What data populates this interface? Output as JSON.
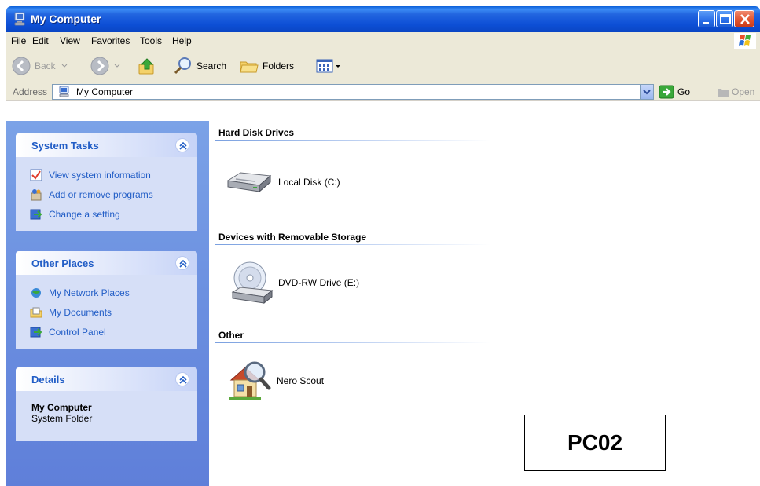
{
  "window": {
    "title": "My Computer"
  },
  "menu": [
    "File",
    "Edit",
    "View",
    "Favorites",
    "Tools",
    "Help"
  ],
  "toolbar": {
    "back_label": "Back",
    "search_label": "Search",
    "folders_label": "Folders"
  },
  "address": {
    "label": "Address",
    "value": "My Computer",
    "go_label": "Go",
    "open_label": "Open"
  },
  "task_pane": {
    "system_tasks": {
      "title": "System Tasks",
      "items": [
        "View system information",
        "Add or remove programs",
        "Change a setting"
      ]
    },
    "other_places": {
      "title": "Other Places",
      "items": [
        "My Network Places",
        "My Documents",
        "Control Panel"
      ]
    },
    "details": {
      "title": "Details",
      "name": "My Computer",
      "type": "System Folder"
    }
  },
  "groups": [
    {
      "title": "Hard Disk Drives",
      "items": [
        "Local Disk (C:)"
      ]
    },
    {
      "title": "Devices with Removable Storage",
      "items": [
        "DVD-RW Drive (E:)"
      ]
    },
    {
      "title": "Other",
      "items": [
        "Nero Scout"
      ]
    }
  ],
  "overlay_label": "PC02",
  "colors": {
    "title_bar": "#0a46c4",
    "task_pane": "#6b8fe0",
    "link": "#215dc6",
    "chrome": "#ece9d8"
  }
}
